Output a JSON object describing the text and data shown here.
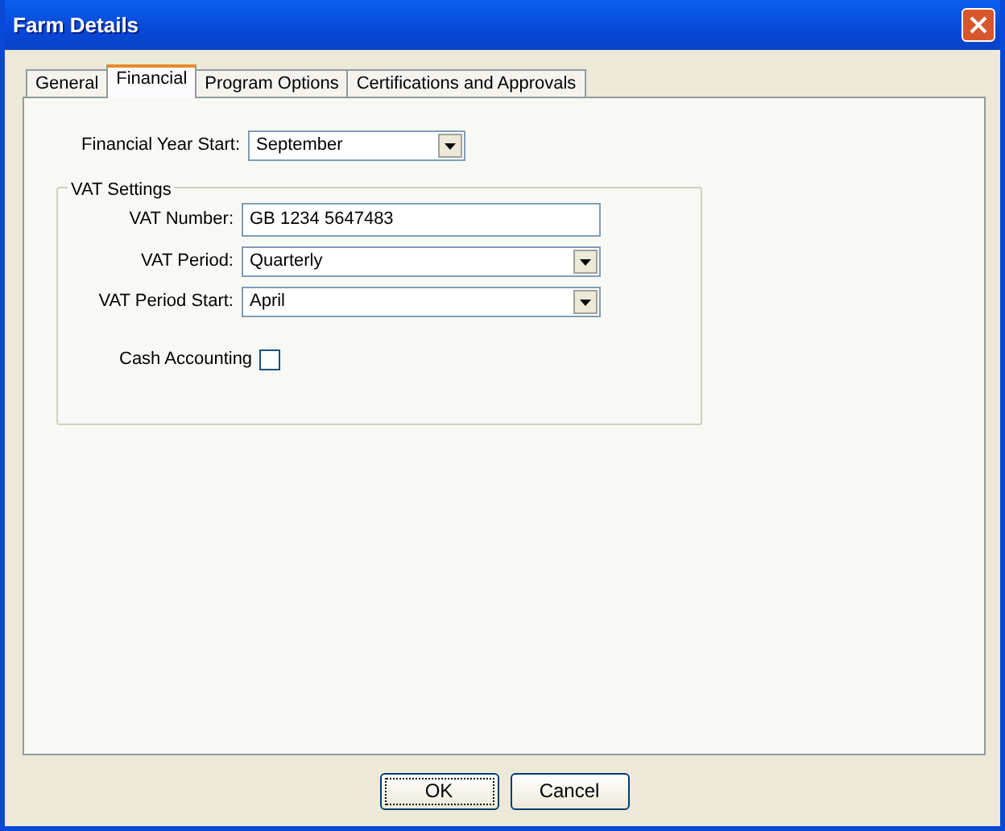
{
  "window": {
    "title": "Farm Details"
  },
  "tabs": [
    {
      "label": "General",
      "selected": false
    },
    {
      "label": "Financial",
      "selected": true
    },
    {
      "label": "Program Options",
      "selected": false
    },
    {
      "label": "Certifications and Approvals",
      "selected": false
    }
  ],
  "financial_year_start": {
    "label": "Financial Year Start:",
    "value": "September"
  },
  "vat_settings": {
    "title": "VAT Settings",
    "fields": [
      {
        "kind": "text",
        "label": "VAT Number:",
        "value": "GB 1234 5647483"
      },
      {
        "kind": "dropdown",
        "label": "VAT Period:",
        "value": "Quarterly"
      },
      {
        "kind": "dropdown",
        "label": "VAT Period Start:",
        "value": "April"
      }
    ],
    "cash_accounting": {
      "label": "Cash Accounting",
      "checked": false
    }
  },
  "buttons": [
    "OK",
    "Cancel"
  ]
}
